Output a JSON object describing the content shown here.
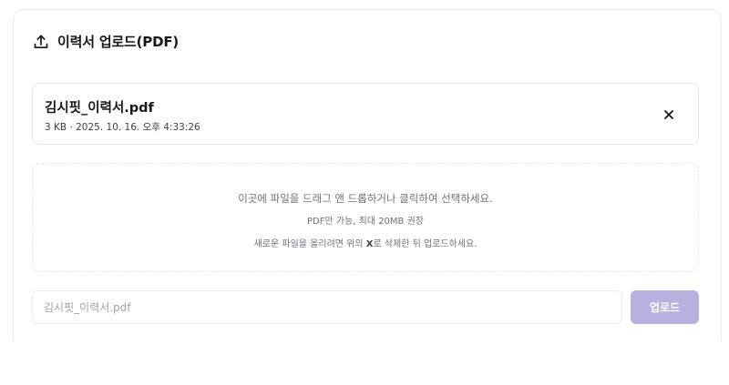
{
  "header": {
    "icon": "upload-icon",
    "title": "이력서 업로드(PDF)"
  },
  "file": {
    "name": "김시핏_이력서.pdf",
    "meta": "3 KB · 2025. 10. 16. 오후 4:33:26",
    "remove_icon": "close-icon"
  },
  "dropzone": {
    "line1": "이곳에 파일을 드래그 앤 드롭하거나 클릭하여 선택하세요.",
    "line2": "PDF만 가능, 최대 20MB 권장",
    "line3_before": "새로운 파일을 올리려면 위의 ",
    "line3_bold": "X",
    "line3_after": "로 삭제한 뒤 업로드하세요."
  },
  "form": {
    "filename_placeholder": "김시핏_이력서.pdf",
    "upload_label": "업로드"
  },
  "colors": {
    "primary_disabled": "#b6b1de",
    "text_main": "#18181b",
    "text_muted": "#71717a",
    "border": "#e7e7eb"
  }
}
